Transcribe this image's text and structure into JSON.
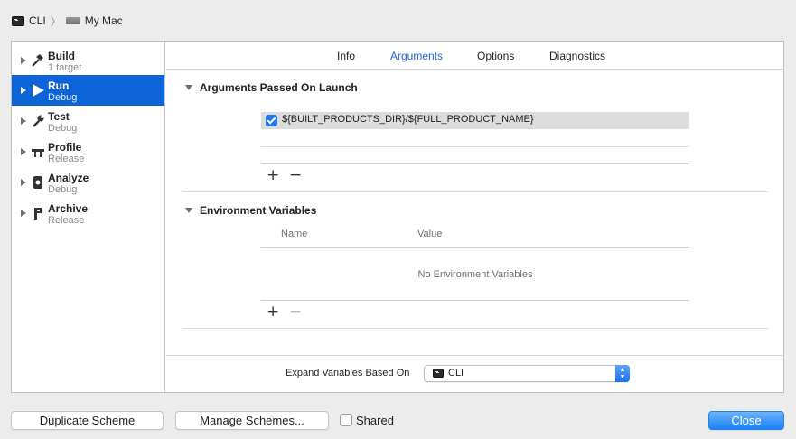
{
  "breadcrumb": {
    "scheme": "CLI",
    "destination": "My Mac"
  },
  "sidebar": {
    "items": [
      {
        "name": "Build",
        "sub": "1 target",
        "icon": "hammer-icon"
      },
      {
        "name": "Run",
        "sub": "Debug",
        "icon": "play-icon"
      },
      {
        "name": "Test",
        "sub": "Debug",
        "icon": "wrench-icon"
      },
      {
        "name": "Profile",
        "sub": "Release",
        "icon": "profile-icon"
      },
      {
        "name": "Analyze",
        "sub": "Debug",
        "icon": "analyze-icon"
      },
      {
        "name": "Archive",
        "sub": "Release",
        "icon": "archive-icon"
      }
    ],
    "selected": "Run"
  },
  "tabs": [
    {
      "label": "Info"
    },
    {
      "label": "Arguments"
    },
    {
      "label": "Options"
    },
    {
      "label": "Diagnostics"
    }
  ],
  "active_tab": "Arguments",
  "arguments_section": {
    "title": "Arguments Passed On Launch",
    "arguments": [
      {
        "value": "${BUILT_PRODUCTS_DIR}/${FULL_PRODUCT_NAME}",
        "checked": true
      }
    ],
    "add": "+",
    "remove": "−"
  },
  "env_section": {
    "title": "Environment Variables",
    "columns": [
      "Name",
      "Value"
    ],
    "empty_text": "No Environment Variables",
    "add": "+",
    "remove": "−"
  },
  "expand_variables": {
    "label": "Expand Variables Based On",
    "value": "CLI"
  },
  "footer": {
    "duplicate": "Duplicate Scheme",
    "manage": "Manage Schemes...",
    "shared": "Shared",
    "shared_checked": false,
    "close": "Close"
  },
  "colors": {
    "accent": "#1e63d6",
    "selection": "#0d63d8",
    "close_button": "#1a82fb"
  }
}
